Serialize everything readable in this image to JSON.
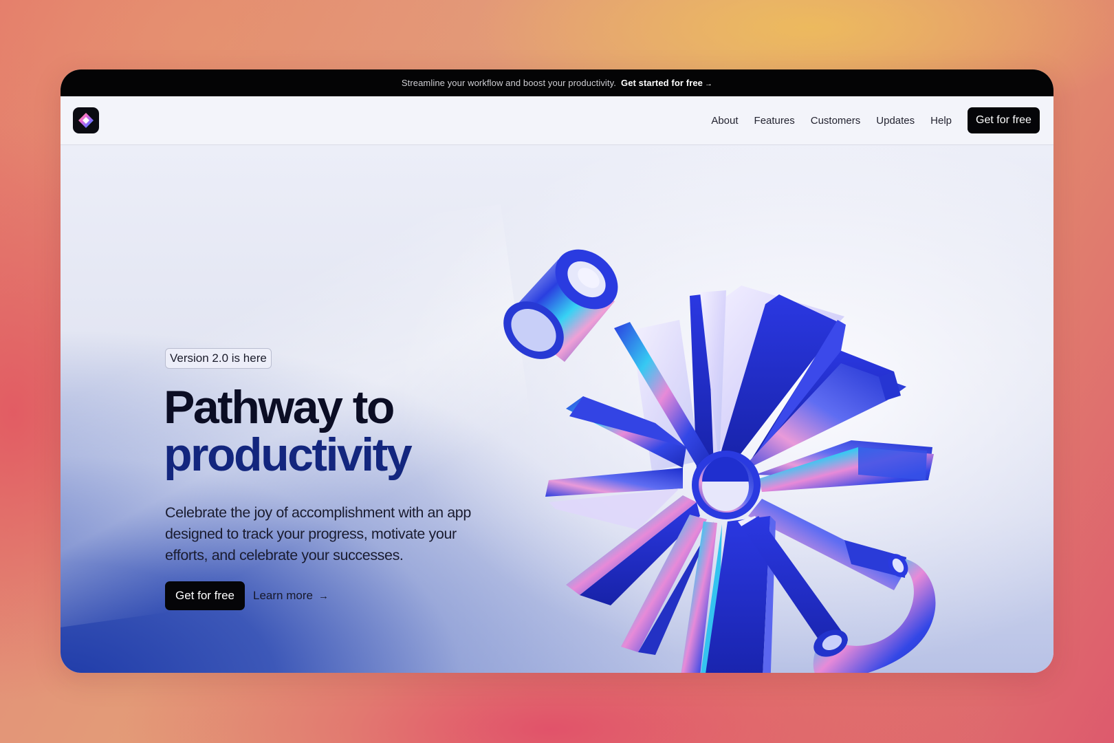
{
  "announcement": {
    "message": "Streamline your workflow and boost your productivity.",
    "cta_label": "Get started for free",
    "cta_arrow": "→"
  },
  "nav": {
    "logo_icon": "diamond-logo-icon",
    "links": [
      "About",
      "Features",
      "Customers",
      "Updates",
      "Help"
    ],
    "cta_label": "Get for free"
  },
  "hero": {
    "badge": "Version 2.0 is here",
    "title_line1": "Pathway to",
    "title_line2": "productivity",
    "subtitle": "Celebrate the joy of accomplishment with an app designed to track your progress, motivate your efforts, and celebrate your successes.",
    "primary_cta": "Get for free",
    "secondary_cta": "Learn more",
    "secondary_arrow": "→",
    "illustration_icons": [
      "iridescent-cylinder-icon",
      "iridescent-starburst-icon",
      "iridescent-hook-icon"
    ]
  },
  "colors": {
    "background_coral": "#e1846e",
    "background_gold": "#e3b777",
    "announcement_bg": "#040405",
    "button_dark": "#050508",
    "title_dark": "#0b0d24",
    "title_blue": "#13267e",
    "accent_blue": "#2438d8",
    "iridescent_cyan": "#2fd6f5",
    "iridescent_pink": "#e98ad8"
  }
}
